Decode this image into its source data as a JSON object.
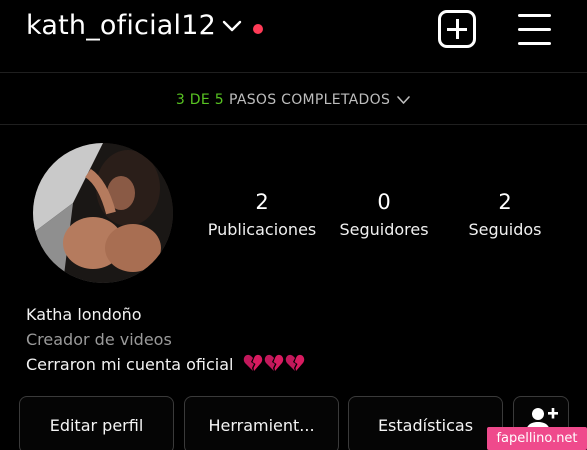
{
  "header": {
    "username": "kath_oficial12",
    "chevron_icon": "chevron-down-icon",
    "notification_dot_color": "#ff3b57",
    "create_icon": "plus-square-icon",
    "menu_icon": "hamburger-menu-icon"
  },
  "setup": {
    "progress": "3 DE 5",
    "label": "PASOS COMPLETADOS",
    "steps_done": 3,
    "steps_total": 5,
    "accent_color": "#58c322"
  },
  "stats": [
    {
      "value": "2",
      "label": "Publicaciones"
    },
    {
      "value": "0",
      "label": "Seguidores"
    },
    {
      "value": "2",
      "label": "Seguidos"
    }
  ],
  "bio": {
    "name": "Katha londoño",
    "category": "Creador de videos",
    "text": "Cerraron mi cuenta oficial",
    "emoji": "broken-heart x3",
    "emoji_color": "#c2185b"
  },
  "actions": {
    "edit_profile": "Editar perfil",
    "tools": "Herramient...",
    "insights": "Estadísticas",
    "discover_icon": "add-person-icon"
  },
  "watermark": "fapellino.net"
}
